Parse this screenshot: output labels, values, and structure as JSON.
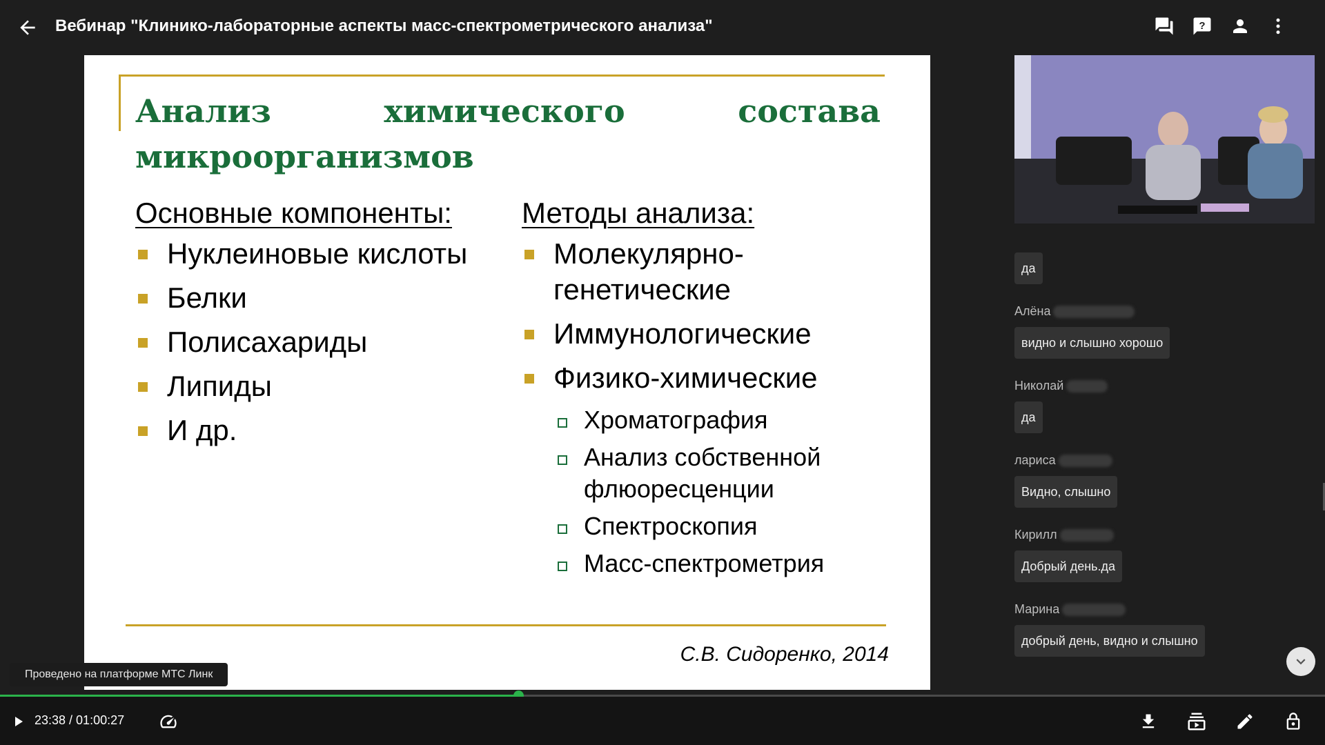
{
  "header": {
    "title": "Вебинар \"Клинико-лабораторные аспекты масс-спектрометрического анализа\"",
    "icons": [
      "back-arrow-icon",
      "chat-icon",
      "question-icon",
      "person-icon",
      "more-vertical-icon"
    ]
  },
  "slide": {
    "title_words": [
      "Анализ",
      "химического",
      "состава"
    ],
    "title_line2": "микроорганизмов",
    "left": {
      "heading": "Основные компоненты:",
      "items": [
        "Нуклеиновые кислоты",
        "Белки",
        "Полисахариды",
        "Липиды",
        "И др."
      ]
    },
    "right": {
      "heading": "Методы анализа:",
      "items": [
        "Молекулярно-генетические",
        "Иммунологические",
        "Физико-химические"
      ],
      "subitems": [
        "Хроматография",
        "Анализ собственной флюоресценции",
        "Спектроскопия",
        "Масс-спектрометрия"
      ]
    },
    "author": "С.В. Сидоренко, 2014",
    "colors": {
      "title": "#1a6e3a",
      "accent": "#c9a227"
    }
  },
  "watermark": "Проведено на платформе МТС Линк",
  "chat": {
    "messages": [
      {
        "name": "",
        "text": "да"
      },
      {
        "name": "Алёна",
        "text": "видно и слышно хорошо"
      },
      {
        "name": "Николай",
        "text": "да"
      },
      {
        "name": "лариса",
        "text": "Видно, слышно"
      },
      {
        "name": "Кирилл",
        "text": "Добрый день.да"
      },
      {
        "name": "Марина",
        "text": "добрый день, видно и слышно"
      }
    ]
  },
  "player": {
    "time": "23:38 / 01:00:27",
    "progress": 0.391,
    "accent": "#2bb34b",
    "icons": [
      "play-icon",
      "speed-icon",
      "download-icon",
      "picture-in-picture-icon",
      "pencil-icon",
      "lock-icon"
    ]
  }
}
